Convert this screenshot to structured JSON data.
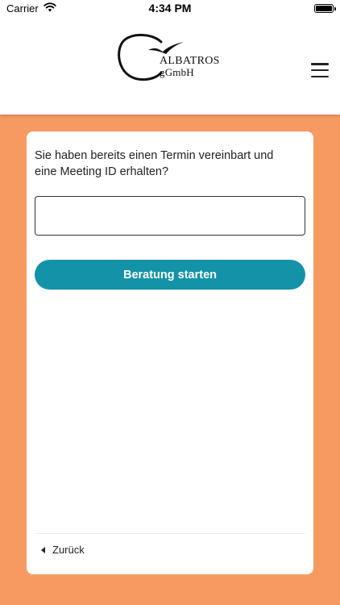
{
  "status_bar": {
    "carrier": "Carrier",
    "time": "4:34 PM"
  },
  "header": {
    "logo": {
      "line1": "ALBATROS",
      "line2": "gGmbH"
    },
    "menu_icon": "hamburger-icon"
  },
  "card": {
    "question": "Sie haben bereits einen Termin vereinbart und eine Meeting ID erhalten?",
    "meeting_id_input": {
      "value": "",
      "placeholder": ""
    },
    "start_button_label": "Beratung starten",
    "back_link_label": "Zurück"
  },
  "colors": {
    "background": "#F79A62",
    "accent": "#1493A8",
    "card": "#FFFFFF"
  }
}
